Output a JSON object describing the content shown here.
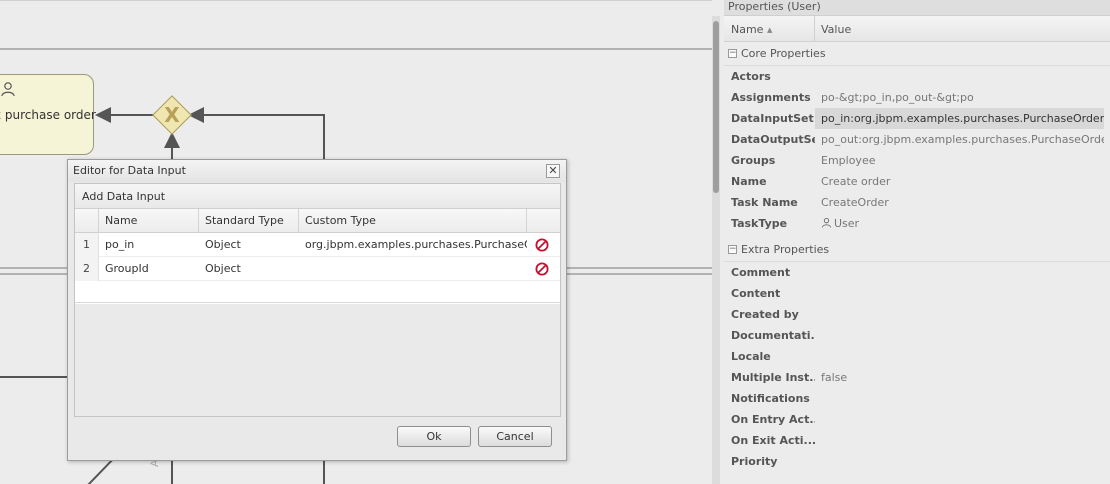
{
  "canvas": {
    "task_label": "x purchase order"
  },
  "dialog": {
    "title": "Editor for Data Input",
    "toolbar_label": "Add Data Input",
    "columns": {
      "name": "Name",
      "standard_type": "Standard Type",
      "custom_type": "Custom Type"
    },
    "rows": [
      {
        "num": "1",
        "name": "po_in",
        "standard_type": "Object",
        "custom_type": "org.jbpm.examples.purchases.PurchaseO..."
      },
      {
        "num": "2",
        "name": "GroupId",
        "standard_type": "Object",
        "custom_type": ""
      }
    ],
    "ok_label": "Ok",
    "cancel_label": "Cancel"
  },
  "properties": {
    "title": "Properties (User)",
    "col_name": "Name",
    "col_value": "Value",
    "sort_glyph": "▲",
    "core_section": "Core Properties",
    "core": [
      {
        "name": "Actors",
        "value": ""
      },
      {
        "name": "Assignments",
        "value": "po-&gt;po_in,po_out-&gt;po"
      },
      {
        "name": "DataInputSet",
        "value": "po_in:org.jbpm.examples.purchases.PurchaseOrder,G...",
        "selected": true
      },
      {
        "name": "DataOutputSet",
        "value": "po_out:org.jbpm.examples.purchases.PurchaseOrder"
      },
      {
        "name": "Groups",
        "value": "Employee"
      },
      {
        "name": "Name",
        "value": "Create order"
      },
      {
        "name": "Task Name",
        "value": "CreateOrder"
      },
      {
        "name": "TaskType",
        "value": "User"
      }
    ],
    "extra_section": "Extra Properties",
    "extra": [
      {
        "name": "Comment",
        "value": ""
      },
      {
        "name": "Content",
        "value": ""
      },
      {
        "name": "Created by",
        "value": ""
      },
      {
        "name": "Documentati...",
        "value": ""
      },
      {
        "name": "Locale",
        "value": ""
      },
      {
        "name": "Multiple Inst...",
        "value": "false"
      },
      {
        "name": "Notifications",
        "value": ""
      },
      {
        "name": "On Entry Act...",
        "value": ""
      },
      {
        "name": "On Exit Acti...",
        "value": ""
      },
      {
        "name": "Priority",
        "value": ""
      }
    ]
  },
  "colors": {
    "task_fill": "#f5f4d6",
    "gateway_fill": "#efe6b2",
    "delete_icon": "#c8102e",
    "selected_row": "#d8d8d8"
  }
}
